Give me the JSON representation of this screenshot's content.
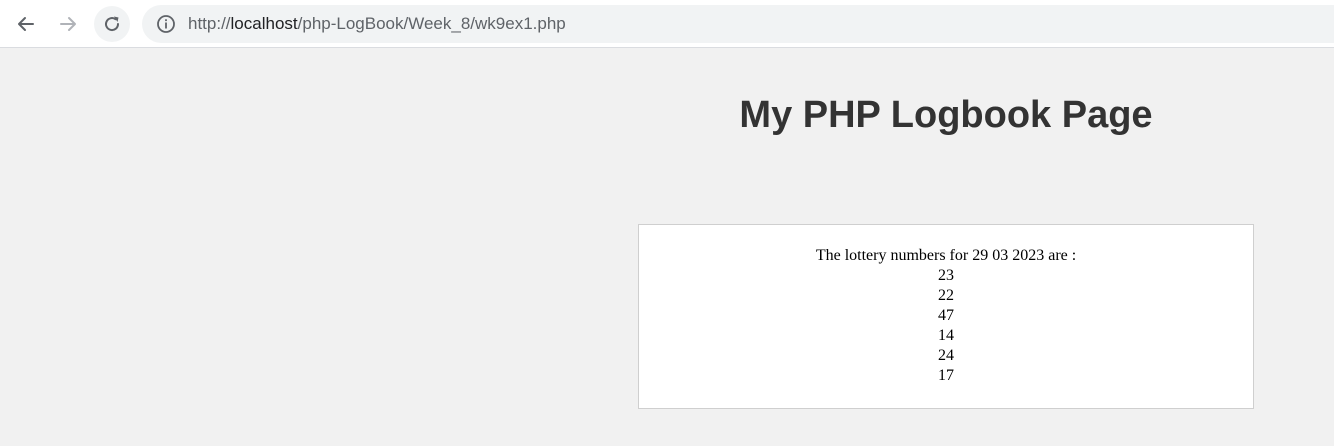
{
  "browser": {
    "url_prefix": "http://",
    "url_host": "localhost",
    "url_path": "/php-LogBook/Week_8/wk9ex1.php"
  },
  "page": {
    "title": "My PHP Logbook Page",
    "intro": "The lottery numbers for 29 03 2023 are :",
    "numbers": [
      "23",
      "22",
      "47",
      "14",
      "24",
      "17"
    ]
  }
}
